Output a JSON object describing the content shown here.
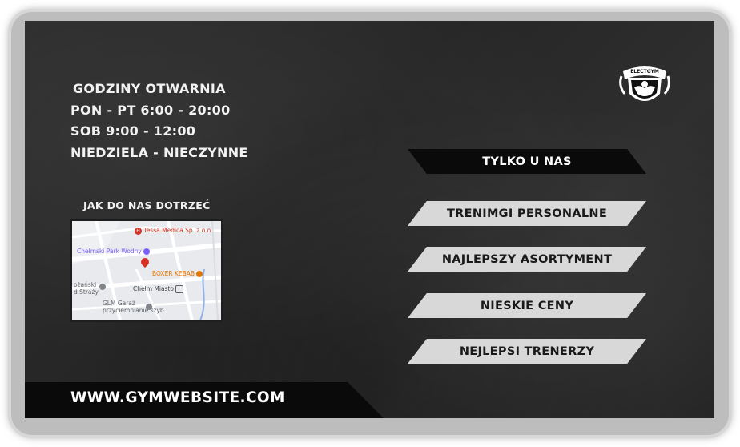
{
  "hours": {
    "title": "GODZINY OTWARNIA",
    "weekdays": "PON - PT 6:00 - 20:00",
    "saturday": "SOB 9:00 - 12:00",
    "sunday": "NIEDZIELA - NIECZYNNE"
  },
  "map": {
    "title": "JAK DO NAS DOTRZEĆ",
    "places": {
      "medica": "Tessa Medica Sp. z o.o",
      "park": "Chełmski Park Wodny",
      "kebab": "BOXER KEBAB",
      "station": "Chełm Miasto",
      "fire1": "ożański",
      "fire2": "d Straży",
      "garage1": "GLM Garaż",
      "garage2": "przyciemnianie szyb"
    },
    "colors": {
      "pin": "#d93025",
      "kebab": "#e37400",
      "park": "#7b61ff",
      "medica": "#d93025"
    }
  },
  "logo": {
    "text": "ELECTGYM",
    "icon": "bodybuilder-shield-icon"
  },
  "offers": {
    "header": "TYLKO U NAS",
    "items": [
      "TRENIMGI PERSONALNE",
      "NAJLEPSZY ASORTYMENT",
      "NIESKIE CENY",
      "NEJLEPSI TRENERZY"
    ]
  },
  "footer": {
    "url": "WWW.GYMWEBSITE.COM"
  }
}
